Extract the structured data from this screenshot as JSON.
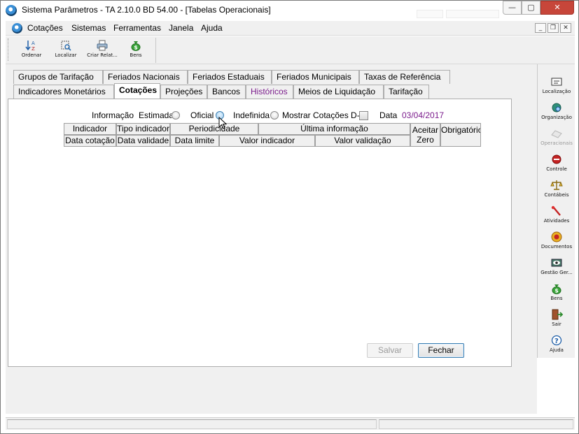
{
  "window": {
    "title": "Sistema Parâmetros -  TA 2.10.0 BD 54.00 - [Tabelas Operacionais]",
    "minimize": "—",
    "maximize": "▢",
    "close": "✕"
  },
  "menu": {
    "items": [
      "Cotações",
      "Sistemas",
      "Ferramentas",
      "Janela",
      "Ajuda"
    ],
    "mdi_min": "_",
    "mdi_restore": "❐",
    "mdi_close": "✕"
  },
  "toolbar": {
    "buttons": [
      {
        "label": "Ordenar",
        "icon": "sort-az-icon"
      },
      {
        "label": "Localizar",
        "icon": "locate-icon"
      },
      {
        "label": "Criar Relat...",
        "icon": "printer-icon"
      },
      {
        "label": "Bens",
        "icon": "money-bag-icon"
      }
    ]
  },
  "sidebar": {
    "items": [
      {
        "label": "Localização",
        "icon": "location-icon",
        "enabled": true
      },
      {
        "label": "Organização",
        "icon": "organization-icon",
        "enabled": true
      },
      {
        "label": "Operacionais",
        "icon": "operations-icon",
        "enabled": false
      },
      {
        "label": "Controle",
        "icon": "control-icon",
        "enabled": true
      },
      {
        "label": "Contábeis",
        "icon": "scale-icon",
        "enabled": true
      },
      {
        "label": "Atividades",
        "icon": "activities-icon",
        "enabled": true
      },
      {
        "label": "Documentos",
        "icon": "documents-icon",
        "enabled": true
      },
      {
        "label": "Gestão Ger...",
        "icon": "management-icon",
        "enabled": true
      },
      {
        "label": "Bens",
        "icon": "money-bag-icon",
        "enabled": true
      },
      {
        "label": "Sair",
        "icon": "exit-icon",
        "enabled": true
      },
      {
        "label": "Ajuda",
        "icon": "help-icon",
        "enabled": true
      }
    ]
  },
  "tabs": {
    "row1": [
      "Grupos de Tarifação",
      "Feriados Nacionais",
      "Feriados Estaduais",
      "Feriados Municipais",
      "Taxas de Referência"
    ],
    "row2": [
      "Indicadores Monetários",
      "Cotações",
      "Projeções",
      "Bancos",
      "Históricos",
      "Meios de Liquidação",
      "Tarifação"
    ],
    "active": "Cotações"
  },
  "filters": {
    "info_label": "Informação",
    "estimada": "Estimada",
    "oficial": "Oficial",
    "indefinida": "Indefinida",
    "mostrar_d0": "Mostrar Cotações D-0",
    "date_label": "Data",
    "date_value": "03/04/2017"
  },
  "grid": {
    "row1": [
      "Indicador",
      "Tipo indicador",
      "Periodicidade",
      "Última informação"
    ],
    "row2": [
      "Data cotação",
      "Data validade",
      "Data limite",
      "Valor indicador",
      "Valor validação"
    ],
    "aceitar_zero": "Aceitar Zero",
    "obrigatorio": "Obrigatório"
  },
  "actions": {
    "salvar": "Salvar",
    "fechar": "Fechar"
  }
}
